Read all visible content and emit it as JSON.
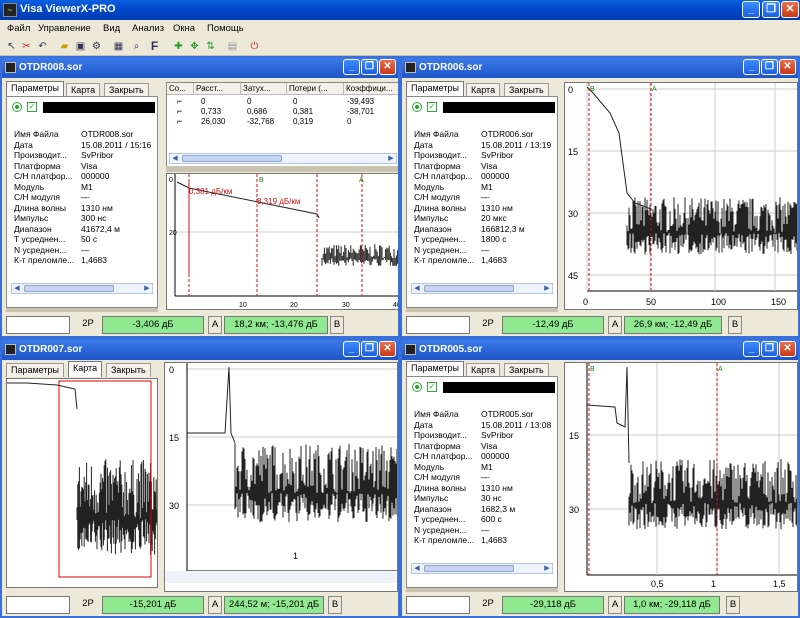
{
  "app": {
    "title": "Visa ViewerX-PRO"
  },
  "menu": [
    "Файл",
    "Управление",
    "Вид",
    "Анализ",
    "Окна",
    "Помощь"
  ],
  "tabs": {
    "params": "Параметры",
    "map": "Карта",
    "close": "Закрыть"
  },
  "labels": {
    "file": "Имя Файла",
    "date": "Дата",
    "manuf": "Производит...",
    "platform": "Платформа",
    "sn_platform": "С/Н платфор...",
    "module": "Модуль",
    "sn_module": "С/Н модуля",
    "wavelength": "Длина волны",
    "pulse": "Импульс",
    "range": "Диапазон",
    "t_avg": "Т усреднен...",
    "n_avg": "N усреднен...",
    "ior": "К-т преломле..."
  },
  "w1": {
    "title": "OTDR008.sor",
    "props": {
      "file": "OTDR008.sor",
      "date": "15.08.2011 / 15:16",
      "manuf": "SvPribor",
      "platform": "Visa",
      "sn_platform": "000000",
      "module": "M1",
      "sn_module": "—",
      "wavelength": "1310 нм",
      "pulse": "300 нс",
      "range": "41672,4 м",
      "t_avg": "50 с",
      "n_avg": "—",
      "ior": "1,4683"
    },
    "table": {
      "headers": [
        "Со...",
        "Расст...",
        "Затух...",
        "Потери (...",
        "Коэффици..."
      ],
      "rows": [
        [
          "0",
          "0",
          "0",
          "-39,493"
        ],
        [
          "0,733",
          "0,686",
          "0,381",
          "-38,701"
        ],
        [
          "26,030",
          "-32,768",
          "0,319",
          "0"
        ]
      ]
    },
    "graph": {
      "y_ticks": [
        "0",
        "20"
      ],
      "x_ticks": [
        "10",
        "20",
        "30",
        "40"
      ],
      "annot1": "0,381 дБ/км",
      "annot2": "8,319 дБ/км",
      "marker_a": "A",
      "marker_b": "B"
    },
    "status": {
      "mode": "2Р",
      "val": "-3,406 дБ",
      "a": "A",
      "pos": "18,2 км; -13,476 дБ",
      "b": "B"
    }
  },
  "w2": {
    "title": "OTDR006.sor",
    "props": {
      "file": "OTDR006.sor",
      "date": "15.08.2011 / 13:19",
      "manuf": "SvPribor",
      "platform": "Visa",
      "sn_platform": "000000",
      "module": "M1",
      "sn_module": "—",
      "wavelength": "1310 нм",
      "pulse": "20 мкс",
      "range": "166812,3 м",
      "t_avg": "1800 с",
      "n_avg": "—",
      "ior": "1,4683"
    },
    "graph": {
      "y_ticks": [
        "0",
        "15",
        "30",
        "45"
      ],
      "x_ticks": [
        "0",
        "50",
        "100",
        "150"
      ],
      "marker_a": "A",
      "marker_b": "B"
    },
    "status": {
      "mode": "2Р",
      "val": "-12,49 дБ",
      "a": "A",
      "pos": "26,9 км; -12,49 дБ",
      "b": "B"
    }
  },
  "w3": {
    "title": "OTDR007.sor",
    "graph": {
      "y_ticks": [
        "0",
        "15",
        "30"
      ],
      "x_ticks": [
        "1"
      ]
    },
    "status": {
      "mode": "2Р",
      "val": "-15,201 дБ",
      "a": "A",
      "pos": "244,52 м; -15,201 дБ",
      "b": "B"
    }
  },
  "w4": {
    "title": "OTDR005.sor",
    "props": {
      "file": "OTDR005.sor",
      "date": "15.08.2011 / 13:08",
      "manuf": "SvPribor",
      "platform": "Visa",
      "sn_platform": "000000",
      "module": "M1",
      "sn_module": "—",
      "wavelength": "1310 нм",
      "pulse": "30 нс",
      "range": "1682,3 м",
      "t_avg": "600 с",
      "n_avg": "—",
      "ior": "1,4683"
    },
    "graph": {
      "y_ticks": [
        "15",
        "30"
      ],
      "x_ticks": [
        "0,5",
        "1",
        "1,5"
      ],
      "marker_a": "A",
      "marker_b": "B"
    },
    "status": {
      "mode": "2Р",
      "val": "-29,118 дБ",
      "a": "A",
      "pos": "1,0 км; -29,118 дБ",
      "b": "B"
    }
  },
  "colors": {
    "green_box": "#90e890",
    "title_blue": "#1d55c8",
    "cursor_red": "#d01010",
    "marker_green": "#118811"
  }
}
